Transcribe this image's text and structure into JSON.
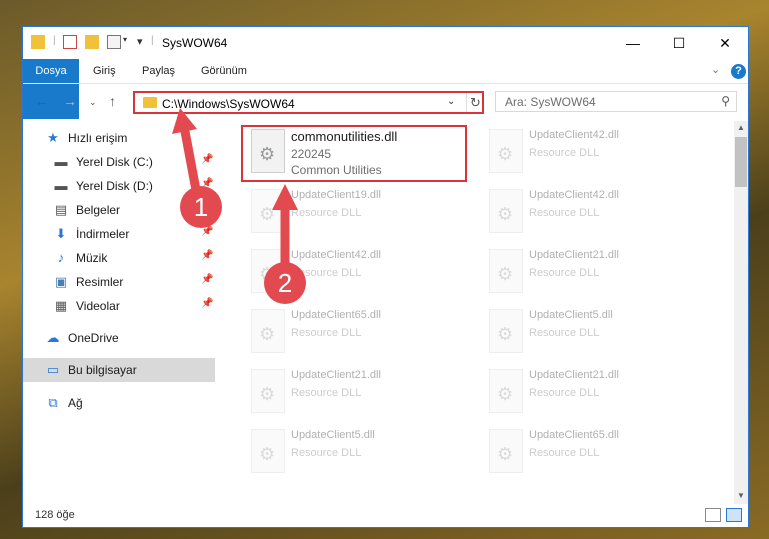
{
  "window": {
    "title": "SysWOW64",
    "controls": {
      "minimize": "—",
      "maximize": "☐",
      "close": "✕"
    }
  },
  "ribbon": {
    "tabs": [
      "Dosya",
      "Giriş",
      "Paylaş",
      "Görünüm"
    ],
    "help": "?"
  },
  "nav": {
    "address": "C:\\Windows\\SysWOW64",
    "search_placeholder": "Ara: SysWOW64"
  },
  "sidebar": {
    "items": [
      {
        "label": "Hızlı erişim",
        "icon": "star-icon"
      },
      {
        "label": "Yerel Disk (C:)",
        "icon": "drive-icon",
        "pinned": true
      },
      {
        "label": "Yerel Disk (D:)",
        "icon": "drive-icon",
        "pinned": true
      },
      {
        "label": "Belgeler",
        "icon": "documents-icon",
        "pinned": true
      },
      {
        "label": "İndirmeler",
        "icon": "download-icon",
        "pinned": true
      },
      {
        "label": "Müzik",
        "icon": "music-icon",
        "pinned": true
      },
      {
        "label": "Resimler",
        "icon": "pictures-icon",
        "pinned": true
      },
      {
        "label": "Videolar",
        "icon": "videos-icon",
        "pinned": true
      },
      {
        "label": "OneDrive",
        "icon": "cloud-icon"
      },
      {
        "label": "Bu bilgisayar",
        "icon": "computer-icon",
        "selected": true
      },
      {
        "label": "Ağ",
        "icon": "network-icon"
      }
    ]
  },
  "files": [
    {
      "name": "commonutilities.dll",
      "line2": "220245",
      "line3": "Common Utilities",
      "highlighted": true
    },
    {
      "name": "UpdateClient42.dll",
      "line2": "Resource DLL"
    },
    {
      "name": "UpdateClient19.dll",
      "line2": "Resource DLL"
    },
    {
      "name": "UpdateClient42.dll",
      "line2": "Resource DLL"
    },
    {
      "name": "UpdateClient42.dll",
      "line2": "Resource DLL"
    },
    {
      "name": "UpdateClient21.dll",
      "line2": "Resource DLL"
    },
    {
      "name": "UpdateClient65.dll",
      "line2": "Resource DLL"
    },
    {
      "name": "UpdateClient5.dll",
      "line2": "Resource DLL"
    },
    {
      "name": "UpdateClient21.dll",
      "line2": "Resource DLL"
    },
    {
      "name": "UpdateClient21.dll",
      "line2": "Resource DLL"
    },
    {
      "name": "UpdateClient5.dll",
      "line2": "Resource DLL"
    },
    {
      "name": "UpdateClient65.dll",
      "line2": "Resource DLL"
    }
  ],
  "status": {
    "count": "128 öğe"
  },
  "annotations": {
    "step1": "1",
    "step2": "2"
  },
  "colors": {
    "accent": "#1979ca",
    "highlight": "#d9343a",
    "callout": "#e24a4f"
  }
}
